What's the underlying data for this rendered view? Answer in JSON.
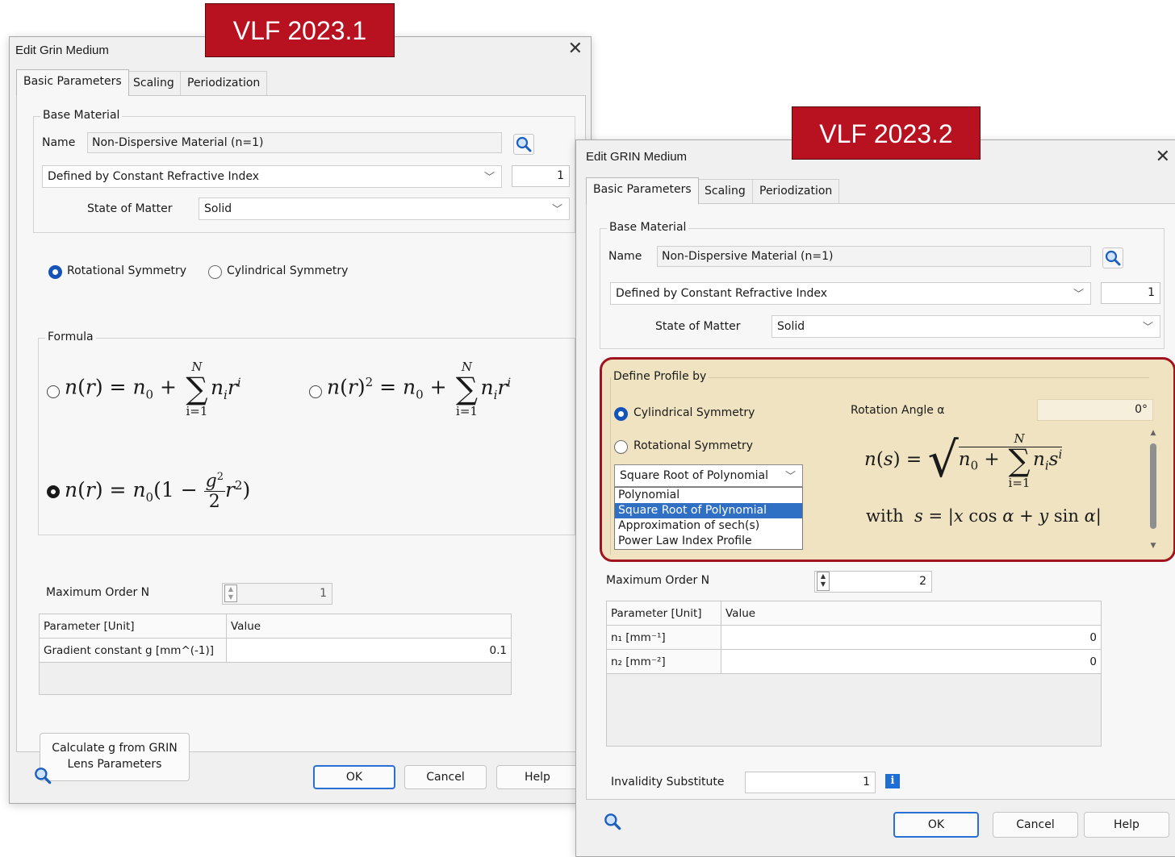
{
  "left": {
    "badge": "VLF 2023.1",
    "title": "Edit Grin Medium",
    "tabs": [
      "Basic Parameters",
      "Scaling",
      "Periodization"
    ],
    "base_material": {
      "group_title": "Base Material",
      "name_label": "Name",
      "name_value": "Non-Dispersive Material (n=1)",
      "definition": "Defined by Constant Refractive Index",
      "index_value": "1",
      "state_label": "State of Matter",
      "state_value": "Solid"
    },
    "symmetry": {
      "rotational": "Rotational Symmetry",
      "cylindrical": "Cylindrical Symmetry",
      "selected": "rotational"
    },
    "formula": {
      "group_title": "Formula",
      "options": [
        "n(r) = n0 + sum_{i=1}^{N} n_i r^i",
        "n(r)^2 = n0 + sum_{i=1}^{N} n_i r^i",
        "n(r) = n0(1 - g^2/2 r^2)"
      ],
      "selected": 2
    },
    "max_order": {
      "label": "Maximum Order N",
      "value": "1"
    },
    "table": {
      "headers": [
        "Parameter [Unit]",
        "Value"
      ],
      "rows": [
        [
          "Gradient constant g [mm^(-1)]",
          "0.1"
        ]
      ]
    },
    "calc_button": [
      "Calculate g from GRIN",
      "Lens Parameters"
    ],
    "footer": {
      "ok": "OK",
      "cancel": "Cancel",
      "help": "Help"
    }
  },
  "right": {
    "badge": "VLF 2023.2",
    "title": "Edit GRIN Medium",
    "tabs": [
      "Basic Parameters",
      "Scaling",
      "Periodization"
    ],
    "base_material": {
      "group_title": "Base Material",
      "name_label": "Name",
      "name_value": "Non-Dispersive Material (n=1)",
      "definition": "Defined by Constant Refractive Index",
      "index_value": "1",
      "state_label": "State of Matter",
      "state_value": "Solid"
    },
    "profile": {
      "group_title": "Define Profile by",
      "cylindrical": "Cylindrical Symmetry",
      "rotational": "Rotational Symmetry",
      "selected": "cylindrical",
      "rotation_label": "Rotation Angle α",
      "rotation_value": "0°",
      "profile_type": "Square Root of Polynomial",
      "profile_options": [
        "Polynomial",
        "Square Root of Polynomial",
        "Approximation of sech(s)",
        "Power Law Index Profile"
      ],
      "profile_selected": 1,
      "formula_text": "n(s) = sqrt(n0 + sum_{i=1}^{N} n_i s^i) with s = |x cos α + y sin α|"
    },
    "max_order": {
      "label": "Maximum Order N",
      "value": "2"
    },
    "table": {
      "headers": [
        "Parameter [Unit]",
        "Value"
      ],
      "rows": [
        [
          "n₁ [mm⁻¹]",
          "0"
        ],
        [
          "n₂ [mm⁻²]",
          "0"
        ]
      ]
    },
    "invalidity": {
      "label": "Invalidity Substitute",
      "value": "1"
    },
    "footer": {
      "ok": "OK",
      "cancel": "Cancel",
      "help": "Help"
    }
  },
  "colors": {
    "badge": "#b81220",
    "accent": "#1553b8",
    "highlight_fill": "#efe3c1",
    "highlight_border": "#a0131f",
    "selection": "#2f6fc4"
  }
}
